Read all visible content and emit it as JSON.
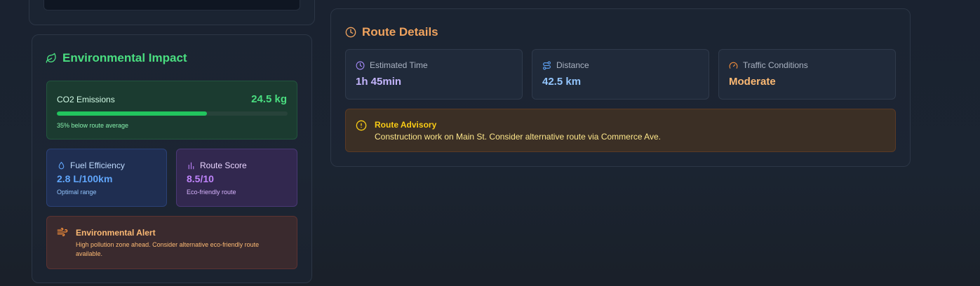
{
  "environmental_impact": {
    "title": "Environmental Impact",
    "title_icon": "leaf-icon",
    "co2": {
      "label": "CO2 Emissions",
      "value": "24.5 kg",
      "progress_percent": 65,
      "note": "35% below route average"
    },
    "fuel_efficiency": {
      "icon": "droplet-icon",
      "label": "Fuel Efficiency",
      "value": "2.8 L/100km",
      "note": "Optimal range"
    },
    "route_score": {
      "icon": "bar-chart-icon",
      "label": "Route Score",
      "value": "8.5/10",
      "note": "Eco-friendly route"
    },
    "alert": {
      "icon": "wind-icon",
      "title": "Environmental Alert",
      "text": "High pollution zone ahead. Consider alternative eco-friendly route available."
    }
  },
  "route_details": {
    "title": "Route Details",
    "title_icon": "clock-icon",
    "stats": {
      "time": {
        "icon": "clock-icon",
        "label": "Estimated Time",
        "value": "1h 45min"
      },
      "distance": {
        "icon": "route-icon",
        "label": "Distance",
        "value": "42.5 km"
      },
      "traffic": {
        "icon": "gauge-icon",
        "label": "Traffic Conditions",
        "value": "Moderate"
      }
    },
    "advisory": {
      "icon": "alert-circle-icon",
      "title": "Route Advisory",
      "text": "Construction work on Main St. Consider alternative route via Commerce Ave."
    }
  },
  "colors": {
    "green_accent": "#4ade80",
    "orange_accent": "#f0a35e",
    "blue_accent": "#60a5fa",
    "purple_accent": "#c084fc",
    "yellow_accent": "#facc15"
  }
}
